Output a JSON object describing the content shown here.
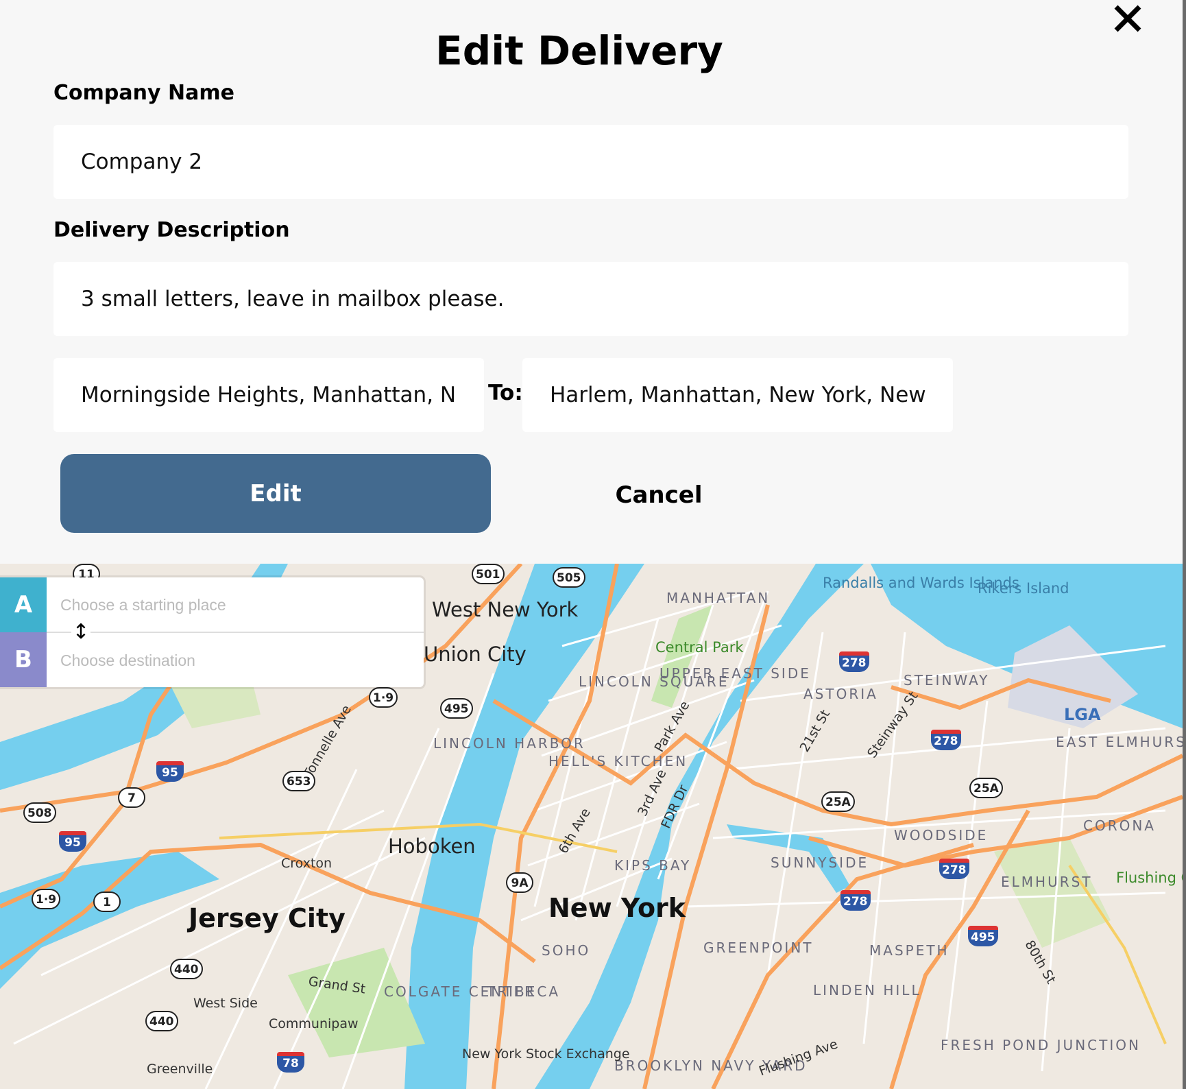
{
  "dialog": {
    "title": "Edit Delivery",
    "close_icon": "close-icon",
    "company_label": "Company Name",
    "company_value": "Company 2",
    "description_label": "Delivery Description",
    "description_value": "3 small letters, leave in mailbox please.",
    "from_value": "Morningside Heights, Manhattan, New York, New York",
    "to_label": "To:",
    "to_value": "Harlem, Manhattan, New York, New York",
    "edit_label": "Edit",
    "cancel_label": "Cancel",
    "accent": "#436a8f"
  },
  "directions": {
    "a_label": "A",
    "b_label": "B",
    "a_color": "#3fb1ce",
    "b_color": "#8a8acb",
    "start_placeholder": "Choose a starting place",
    "dest_placeholder": "Choose destination",
    "swap_icon": "swap-vertical-icon"
  },
  "map": {
    "labels": [
      {
        "text": "West New York",
        "cls": "city"
      },
      {
        "text": "Union City",
        "cls": "city"
      },
      {
        "text": "Hoboken",
        "cls": "city"
      },
      {
        "text": "Jersey City",
        "cls": "big"
      },
      {
        "text": "New York",
        "cls": "big"
      },
      {
        "text": "MANHATTAN",
        "cls": "hood"
      },
      {
        "text": "Central Park",
        "cls": "park"
      },
      {
        "text": "UPPER EAST SIDE",
        "cls": "hood"
      },
      {
        "text": "LINCOLN SQUARE",
        "cls": "hood"
      },
      {
        "text": "LINCOLN HARBOR",
        "cls": "hood"
      },
      {
        "text": "HELL'S KITCHEN",
        "cls": "hood"
      },
      {
        "text": "KIPS BAY",
        "cls": "hood"
      },
      {
        "text": "SOHO",
        "cls": "hood"
      },
      {
        "text": "TRIBECA",
        "cls": "hood"
      },
      {
        "text": "COLGATE CENTER",
        "cls": "hood"
      },
      {
        "text": "ASTORIA",
        "cls": "hood"
      },
      {
        "text": "STEINWAY",
        "cls": "hood"
      },
      {
        "text": "WOODSIDE",
        "cls": "hood"
      },
      {
        "text": "SUNNYSIDE",
        "cls": "hood"
      },
      {
        "text": "GREENPOINT",
        "cls": "hood"
      },
      {
        "text": "MASPETH",
        "cls": "hood"
      },
      {
        "text": "LINDEN HILL",
        "cls": "hood"
      },
      {
        "text": "ELMHURST",
        "cls": "hood"
      },
      {
        "text": "EAST ELMHURST",
        "cls": "hood"
      },
      {
        "text": "CORONA",
        "cls": "hood"
      },
      {
        "text": "FRESH POND JUNCTION",
        "cls": "hood"
      },
      {
        "text": "BROOKLYN NAVY YARD",
        "cls": "hood"
      },
      {
        "text": "Randalls and Wards Islands",
        "cls": "water"
      },
      {
        "text": "Rikers Island",
        "cls": "water"
      },
      {
        "text": "LGA",
        "cls": "air"
      },
      {
        "text": "Croxton",
        "cls": "small"
      },
      {
        "text": "West Side",
        "cls": "small"
      },
      {
        "text": "Communipaw",
        "cls": "small"
      },
      {
        "text": "Greenville",
        "cls": "small"
      },
      {
        "text": "Grand St",
        "cls": "small"
      },
      {
        "text": "Tonnelle Ave",
        "cls": "small"
      },
      {
        "text": "6th Ave",
        "cls": "small"
      },
      {
        "text": "3rd Ave",
        "cls": "small"
      },
      {
        "text": "Park Ave",
        "cls": "small"
      },
      {
        "text": "FDR Dr",
        "cls": "small"
      },
      {
        "text": "21st St",
        "cls": "small"
      },
      {
        "text": "Steinway St",
        "cls": "small"
      },
      {
        "text": "80th St",
        "cls": "small"
      },
      {
        "text": "Flushing Ave",
        "cls": "small"
      },
      {
        "text": "New York Stock Exchange",
        "cls": "small"
      },
      {
        "text": "Flushing Corona",
        "cls": "park"
      }
    ],
    "shields": [
      "11",
      "501",
      "505",
      "1·9",
      "495",
      "95",
      "7",
      "653",
      "508",
      "95",
      "1·9",
      "1",
      "440",
      "440",
      "78",
      "9A",
      "278",
      "278",
      "25A",
      "25A",
      "278",
      "278",
      "495"
    ]
  }
}
